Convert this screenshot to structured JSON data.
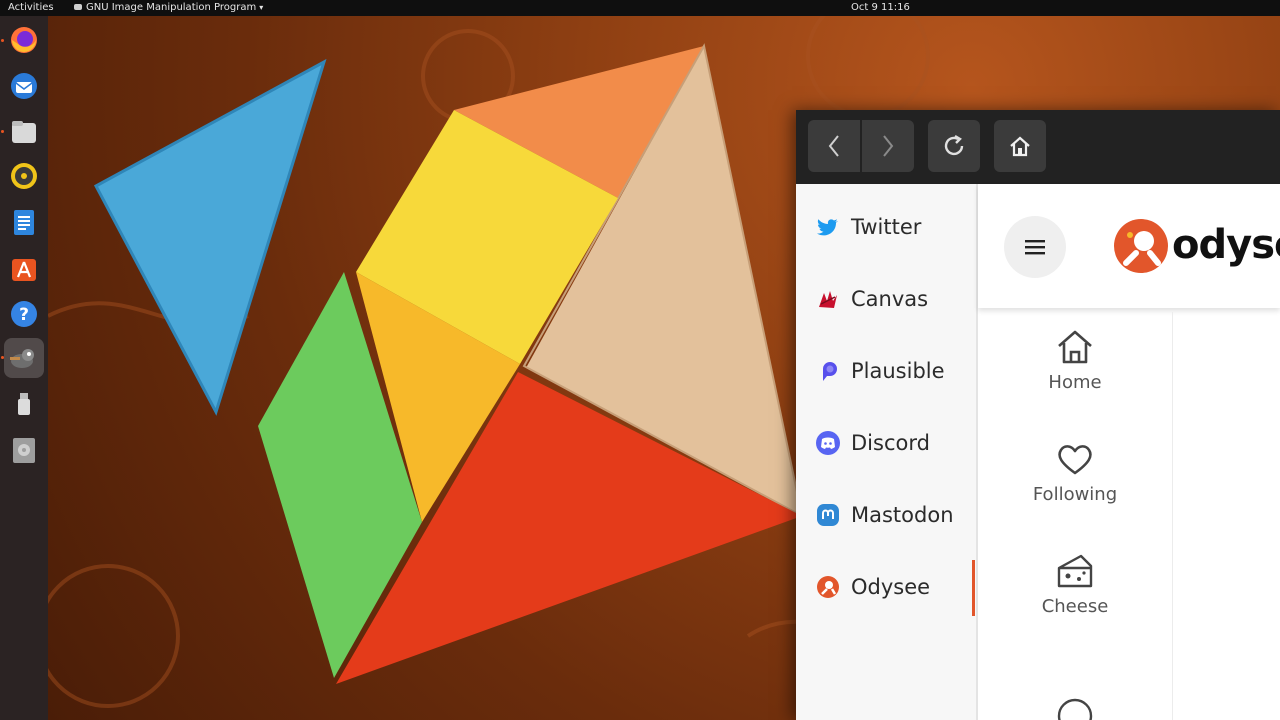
{
  "topbar": {
    "activities": "Activities",
    "app_name": "GNU Image Manipulation Program",
    "clock": "Oct 9  11:16"
  },
  "dock": {
    "items": [
      {
        "name": "firefox-icon",
        "running": true
      },
      {
        "name": "thunderbird-icon",
        "running": false
      },
      {
        "name": "files-icon",
        "running": true
      },
      {
        "name": "rhythmbox-icon",
        "running": false
      },
      {
        "name": "writer-icon",
        "running": false
      },
      {
        "name": "software-icon",
        "running": false
      },
      {
        "name": "help-icon",
        "running": false
      },
      {
        "name": "gimp-icon",
        "running": true,
        "active": true
      },
      {
        "name": "usb-drive-icon",
        "running": false
      },
      {
        "name": "optical-drive-icon",
        "running": false
      }
    ]
  },
  "colors": {
    "accent": "#e95420",
    "odysee_red": "#e2562b",
    "twitter": "#1d9bf0",
    "discord": "#5865f2",
    "mastodon": "#3088d4",
    "plausible": "#5850ec"
  },
  "browser": {
    "toolbar": {
      "back": "back-icon",
      "forward": "forward-icon",
      "reload": "reload-icon",
      "home": "home-icon"
    },
    "sidebar": {
      "items": [
        {
          "label": "Twitter"
        },
        {
          "label": "Canvas"
        },
        {
          "label": "Plausible"
        },
        {
          "label": "Discord"
        },
        {
          "label": "Mastodon"
        },
        {
          "label": "Odysee"
        }
      ],
      "active": "Odysee"
    },
    "odysee": {
      "brand": "odysee",
      "nav": [
        {
          "label": "Home"
        },
        {
          "label": "Following"
        },
        {
          "label": "Cheese"
        }
      ]
    }
  }
}
